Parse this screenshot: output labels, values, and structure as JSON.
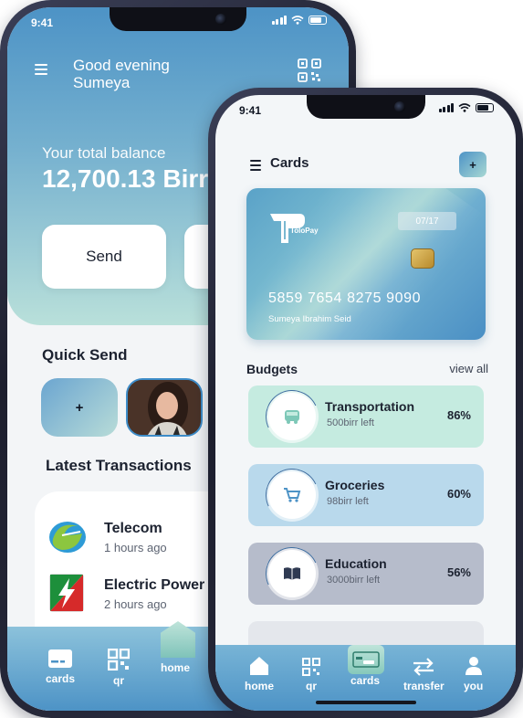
{
  "phone_back": {
    "status_time": "9:41",
    "greeting": "Good evening",
    "user_name": "Sumeya",
    "balance_label": "Your total balance",
    "balance_value": "12,700.13 Birr",
    "send_label": "Send",
    "quick_send_title": "Quick Send",
    "add_contact_label": "+",
    "latest_transactions_title": "Latest Transactions",
    "transactions": [
      {
        "title": "Telecom",
        "time": "1 hours ago"
      },
      {
        "title": "Electric Power",
        "time": "2 hours ago"
      }
    ],
    "nav": {
      "cards": "cards",
      "qr": "qr",
      "home": "home"
    }
  },
  "phone_front": {
    "status_time": "9:41",
    "title": "Cards",
    "add_label": "+",
    "card": {
      "brand": "ToloPay",
      "expiry": "07/17",
      "number": "5859 7654 8275 9090",
      "holder": "Sumeya Ibrahim Seid"
    },
    "budgets_title": "Budgets",
    "view_all": "view all",
    "budgets": [
      {
        "name": "Transportation",
        "left": "500birr left",
        "percent": "86%",
        "color": "#c5ebe0",
        "icon": "bus-icon"
      },
      {
        "name": "Groceries",
        "left": "98birr left",
        "percent": "60%",
        "color": "#b9d9ec",
        "icon": "cart-icon"
      },
      {
        "name": "Education",
        "left": "3000birr left",
        "percent": "56%",
        "color": "#b6bccb",
        "icon": "book-icon"
      }
    ],
    "nav": {
      "home": "home",
      "qr": "qr",
      "cards": "cards",
      "transfer": "transfer",
      "you": "you"
    }
  },
  "colors": {
    "accent_blue": "#4d93c6",
    "accent_mint": "#b8e0da",
    "text_dark": "#1c2230"
  }
}
